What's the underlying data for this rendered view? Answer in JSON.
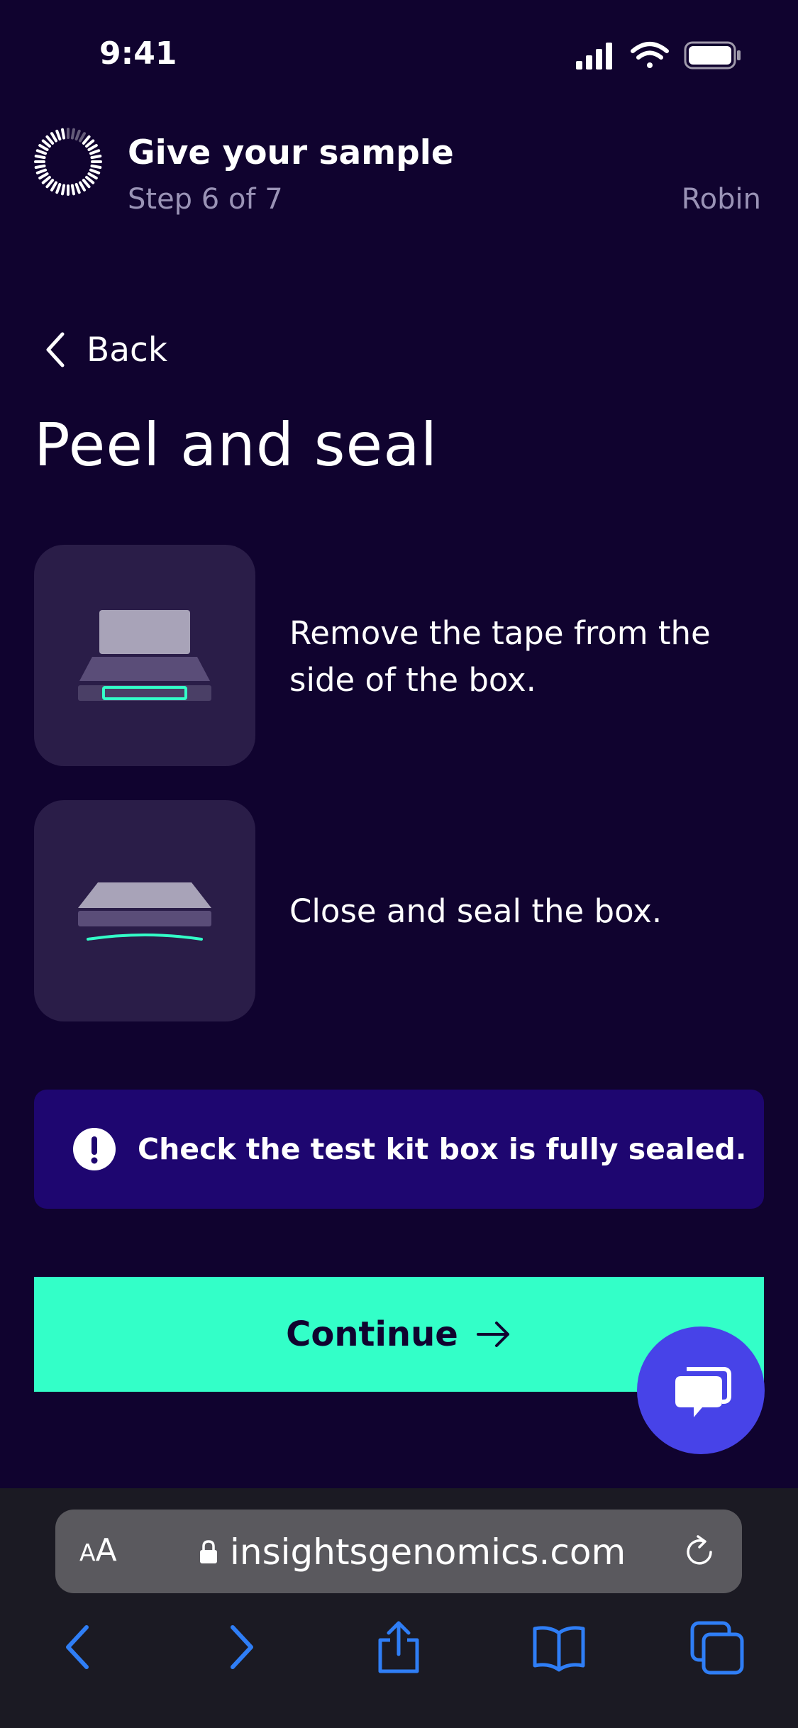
{
  "status_bar": {
    "time": "9:41"
  },
  "header": {
    "title": "Give your sample",
    "step": "Step 6 of 7",
    "user": "Robin"
  },
  "back": {
    "label": "Back"
  },
  "page": {
    "title": "Peel and seal"
  },
  "steps": [
    {
      "text": "Remove the tape from the side of the box.",
      "icon": "box-tape-icon"
    },
    {
      "text": "Close and seal the box.",
      "icon": "box-sealed-icon"
    }
  ],
  "alert": {
    "text": "Check the test kit box is fully sealed.",
    "icon": "exclamation-icon"
  },
  "continue": {
    "label": "Continue"
  },
  "browser": {
    "text_size_label_small": "A",
    "text_size_label_large": "A",
    "url": "insightsgenomics.com"
  },
  "colors": {
    "background": "#10032f",
    "accent": "#33ffc8",
    "alert_bg": "#1e0670",
    "fab": "#4743e8"
  }
}
